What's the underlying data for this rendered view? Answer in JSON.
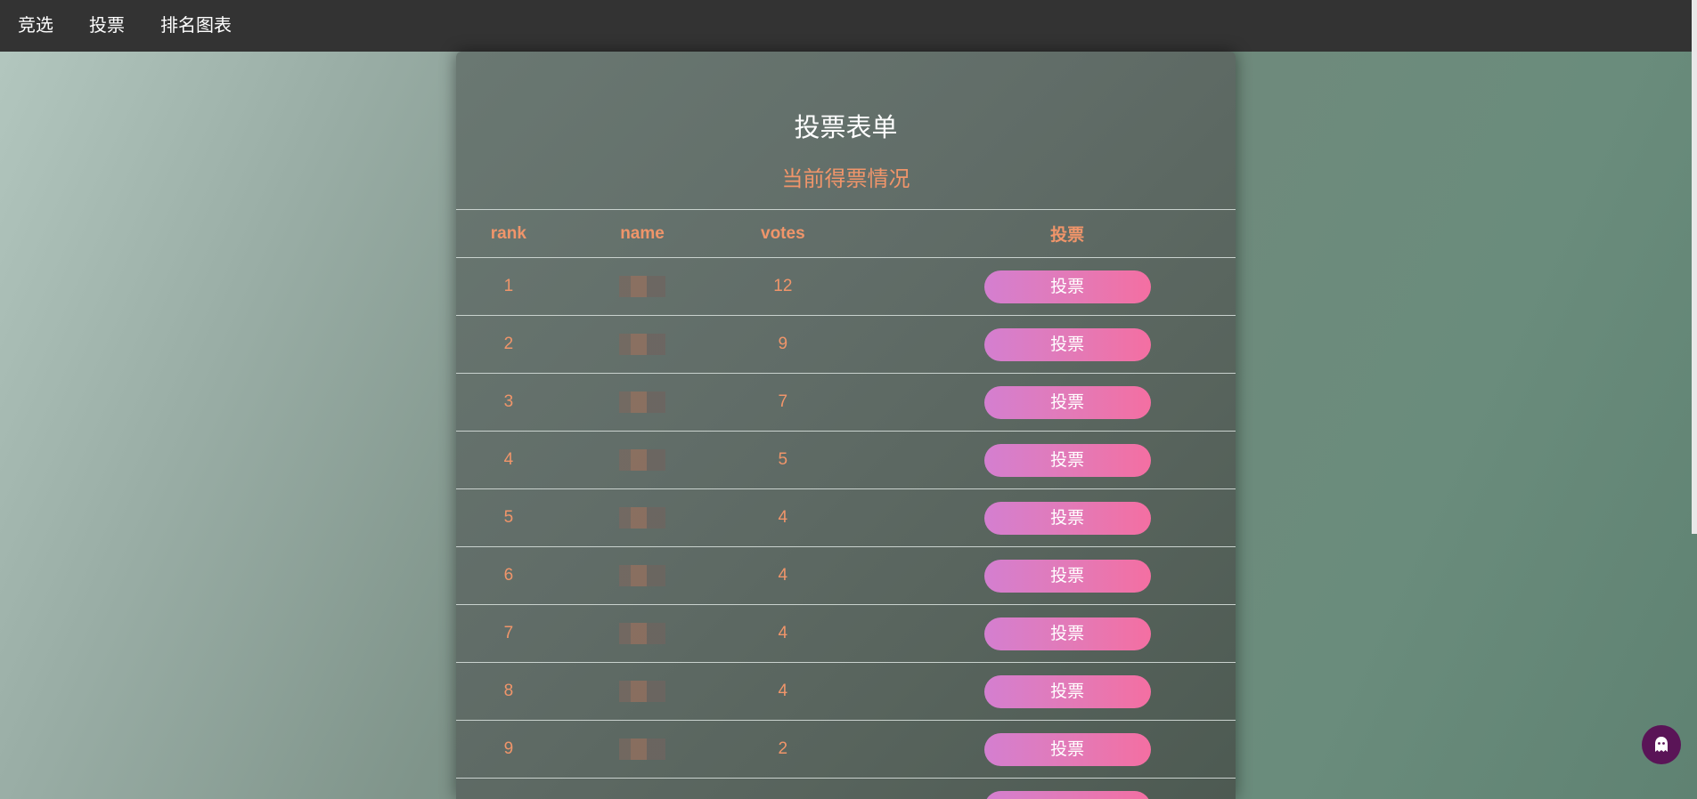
{
  "nav": {
    "items": [
      {
        "label": "竞选"
      },
      {
        "label": "投票"
      },
      {
        "label": "排名图表"
      }
    ]
  },
  "form": {
    "title": "投票表单",
    "subtitle": "当前得票情况"
  },
  "table": {
    "headers": {
      "rank": "rank",
      "name": "name",
      "votes": "votes",
      "action": "投票"
    },
    "rows": [
      {
        "rank": "1",
        "votes": "12",
        "button": "投票"
      },
      {
        "rank": "2",
        "votes": "9",
        "button": "投票"
      },
      {
        "rank": "3",
        "votes": "7",
        "button": "投票"
      },
      {
        "rank": "4",
        "votes": "5",
        "button": "投票"
      },
      {
        "rank": "5",
        "votes": "4",
        "button": "投票"
      },
      {
        "rank": "6",
        "votes": "4",
        "button": "投票"
      },
      {
        "rank": "7",
        "votes": "4",
        "button": "投票"
      },
      {
        "rank": "8",
        "votes": "4",
        "button": "投票"
      },
      {
        "rank": "9",
        "votes": "2",
        "button": "投票"
      },
      {
        "rank": "",
        "votes": "",
        "button": ""
      }
    ]
  },
  "colors": {
    "navbar": "#333333",
    "accent_text": "#f0956a",
    "button_gradient_start": "#d47fd0",
    "button_gradient_end": "#f46fa2",
    "assistant_bubble": "#5a1457"
  },
  "icons": {
    "assistant": "ghost-icon"
  }
}
